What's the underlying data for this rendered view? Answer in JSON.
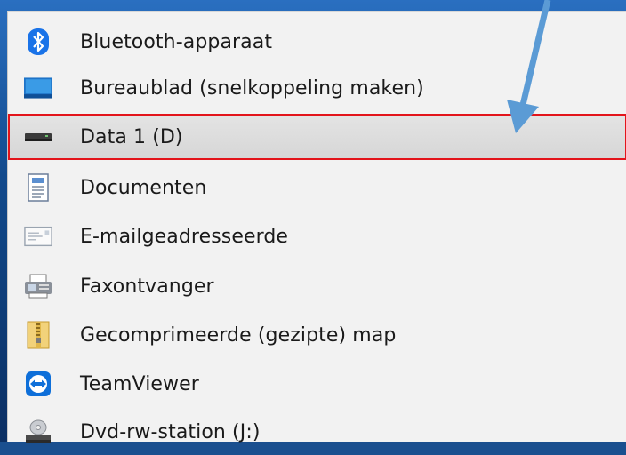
{
  "menu": {
    "items": [
      {
        "label": "Bluetooth-apparaat",
        "icon": "bluetooth-icon"
      },
      {
        "label": "Bureaublad (snelkoppeling maken)",
        "icon": "desktop-icon"
      },
      {
        "label": "Data 1 (D)",
        "icon": "drive-icon",
        "highlighted": true
      },
      {
        "label": "Documenten",
        "icon": "documents-icon"
      },
      {
        "label": "E-mailgeadresseerde",
        "icon": "mail-recipient-icon"
      },
      {
        "label": "Faxontvanger",
        "icon": "fax-icon"
      },
      {
        "label": "Gecomprimeerde (gezipte) map",
        "icon": "zip-folder-icon"
      },
      {
        "label": "TeamViewer",
        "icon": "teamviewer-icon"
      },
      {
        "label": "Dvd-rw-station (J:)",
        "icon": "dvd-drive-icon"
      }
    ]
  },
  "colors": {
    "highlight_border": "#e3141b",
    "arrow": "#5b9bd5",
    "menu_background": "#f2f2f2"
  }
}
